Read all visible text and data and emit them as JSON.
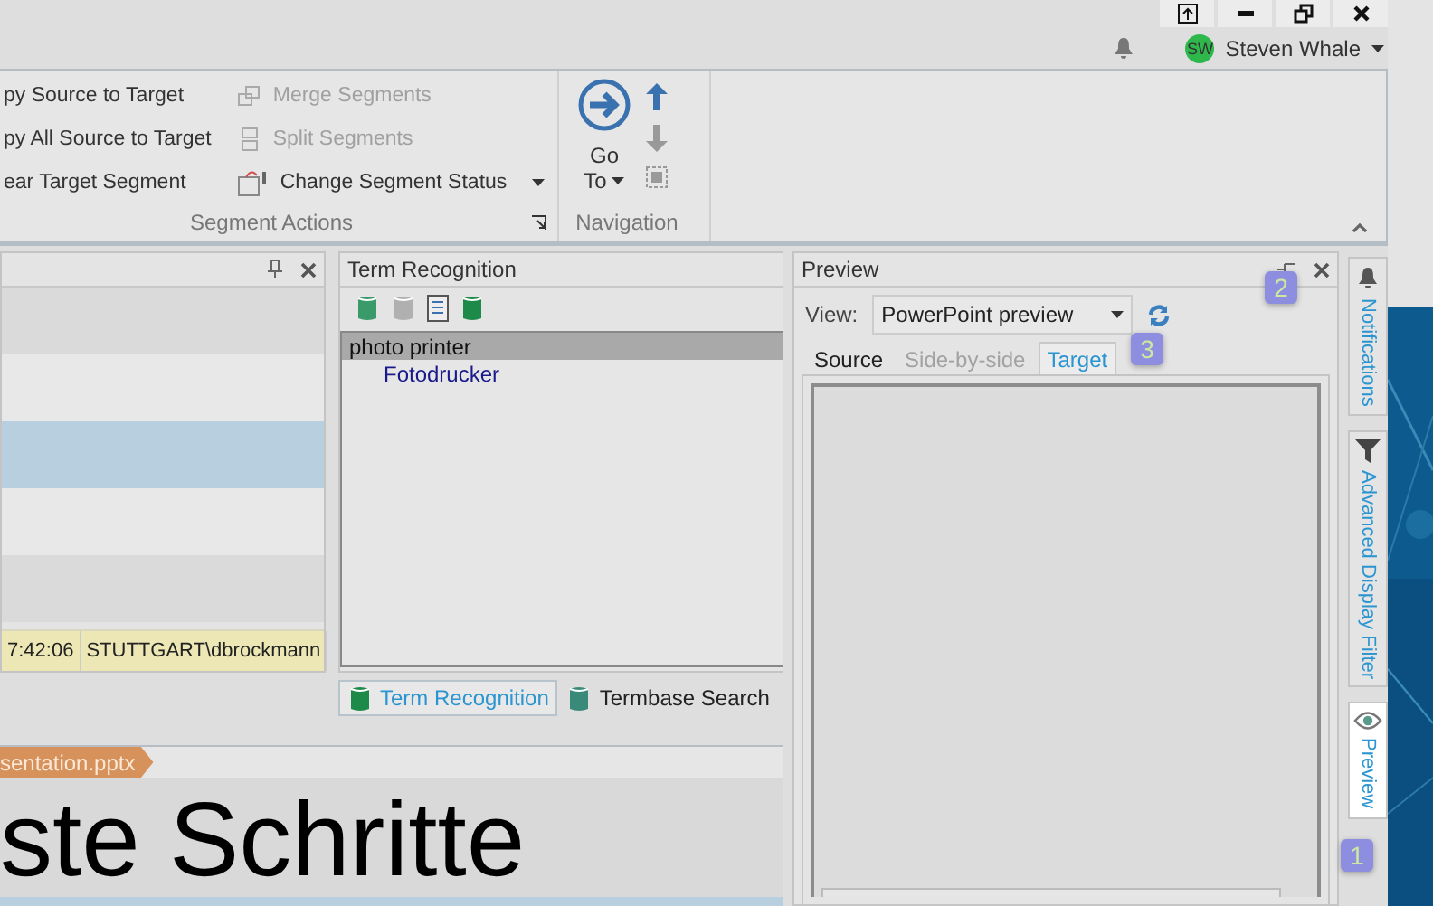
{
  "user": {
    "initials": "SW",
    "name": "Steven Whale"
  },
  "ribbon": {
    "groups": [
      {
        "label": "Segment Actions",
        "columns": [
          [
            {
              "label": "py Source to Target",
              "disabled": false,
              "dropdown": false
            },
            {
              "label": "py All Source to Target",
              "disabled": false,
              "dropdown": false
            },
            {
              "label": "ear Target Segment",
              "disabled": false,
              "dropdown": false
            }
          ],
          [
            {
              "label": "Merge Segments",
              "disabled": true,
              "dropdown": false
            },
            {
              "label": "Split Segments",
              "disabled": true,
              "dropdown": false
            },
            {
              "label": "Change Segment Status",
              "disabled": false,
              "dropdown": true
            }
          ]
        ]
      },
      {
        "label": "Navigation",
        "goto": "Go",
        "goto2": "To"
      }
    ]
  },
  "segments": [
    {
      "selected": false
    },
    {
      "selected": false
    },
    {
      "selected": true
    },
    {
      "selected": false
    },
    {
      "selected": false
    }
  ],
  "status_cells": [
    "7:42:06",
    "STUTTGART\\dbrockmann"
  ],
  "term_recognition": {
    "title": "Term Recognition",
    "terms": [
      {
        "source": "photo printer",
        "selected": true,
        "children": [
          {
            "target": "Fotodrucker"
          }
        ]
      }
    ],
    "tabs": [
      {
        "label": "Term Recognition",
        "selected": true
      },
      {
        "label": "Termbase Search",
        "selected": false
      }
    ]
  },
  "editor": {
    "file_tab": "sentation.pptx",
    "heading": "ste Schritte"
  },
  "preview": {
    "title": "Preview",
    "view_label": "View:",
    "view_value": "PowerPoint preview",
    "tabs": [
      {
        "label": "Source",
        "selected": false,
        "disabled": false
      },
      {
        "label": "Side-by-side",
        "selected": false,
        "disabled": true
      },
      {
        "label": "Target",
        "selected": true,
        "disabled": false
      }
    ]
  },
  "side_tabs": [
    {
      "kind": "bell",
      "label": "Notifications",
      "selected": false
    },
    {
      "kind": "filter",
      "label": "Advanced Display Filter",
      "selected": false
    },
    {
      "kind": "eye",
      "label": "Preview",
      "selected": true
    }
  ],
  "markers": [
    "1",
    "2",
    "3"
  ]
}
